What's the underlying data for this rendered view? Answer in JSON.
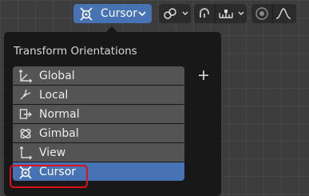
{
  "header": {
    "orientation_button": {
      "label": "Cursor",
      "icon": "cursor-orientation-icon"
    },
    "pivot_icon": "pivot-link-icon",
    "snap_icon": "snap-magnet-icon",
    "snap_target_icon": "snap-increment-icon",
    "proportional_icon": "proportional-edit-icon",
    "falloff_icon": "falloff-curve-icon"
  },
  "popup": {
    "title": "Transform Orientations",
    "add_label": "+",
    "items": [
      {
        "label": "Global",
        "icon": "global-axes-icon",
        "selected": false
      },
      {
        "label": "Local",
        "icon": "local-axes-icon",
        "selected": false
      },
      {
        "label": "Normal",
        "icon": "normal-icon",
        "selected": false
      },
      {
        "label": "Gimbal",
        "icon": "gimbal-icon",
        "selected": false
      },
      {
        "label": "View",
        "icon": "view-axes-icon",
        "selected": false
      },
      {
        "label": "Cursor",
        "icon": "cursor-orientation-icon",
        "selected": true
      }
    ]
  },
  "colors": {
    "accent": "#4772b3",
    "highlight_outline": "#e0101a",
    "popup_bg": "#181818",
    "item_bg": "#545454"
  }
}
